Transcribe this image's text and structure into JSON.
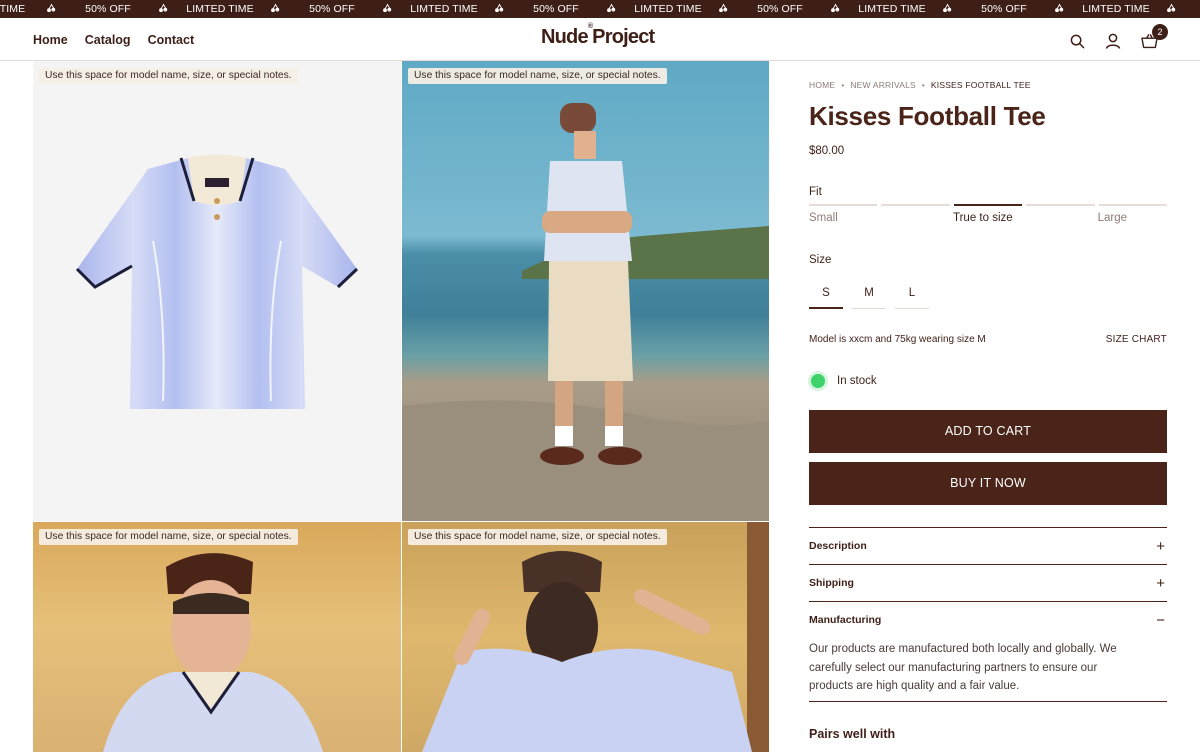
{
  "ticker": {
    "items": [
      "MTED TIME",
      "50% OFF",
      "LIMTED TIME",
      "50% OFF",
      "LIMTED TIME",
      "50% OFF",
      "LIMTED TIME",
      "50% OFF",
      "LIMTED TIME",
      "50% OFF",
      "LIMTED TIME",
      "50% OFF",
      "LI"
    ],
    "icon": "cherries-icon"
  },
  "header": {
    "nav": [
      "Home",
      "Catalog",
      "Contact"
    ],
    "logo_main": "Nude",
    "logo_mark": "®",
    "logo_rest": "Project",
    "cart_count": "2",
    "icons": [
      "search-icon",
      "account-icon",
      "cart-icon"
    ]
  },
  "gallery": {
    "note": "Use this space for model name, size, or special notes."
  },
  "product": {
    "breadcrumb": [
      "HOME",
      "NEW ARRIVALS",
      "KISSES FOOTBALL TEE"
    ],
    "title": "Kisses Football Tee",
    "price": "$80.00",
    "fit_label": "Fit",
    "fit_options": [
      "Small",
      "True to size",
      "Large"
    ],
    "fit_selected_segment": 3,
    "size_label": "Size",
    "sizes": [
      "S",
      "M",
      "L"
    ],
    "size_selected": "S",
    "model_note": "Model is xxcm and 75kg wearing size M",
    "size_chart": "SIZE CHART",
    "stock": "In stock",
    "add_to_cart": "ADD TO CART",
    "buy_now": "BUY IT NOW",
    "accordion": [
      {
        "title": "Description",
        "sign": "+"
      },
      {
        "title": "Shipping",
        "sign": "+"
      },
      {
        "title": "Manufacturing",
        "sign": "−",
        "body": "Our products are manufactured both locally and globally. We carefully select our manufacturing partners to ensure our products are high quality and a fair value."
      }
    ],
    "pairs_heading": "Pairs well with"
  },
  "colors": {
    "brand": "#4a2418",
    "ticker_bg": "#3e1f17",
    "stock_green": "#3ed26a"
  }
}
